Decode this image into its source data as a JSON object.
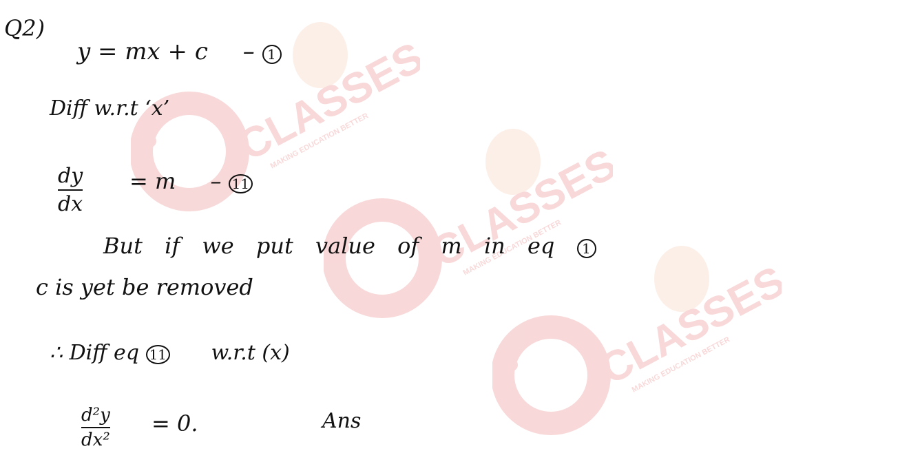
{
  "question_label": "Q2)",
  "eq1": {
    "text": "y = mx + c",
    "dash": "–",
    "tag": "1"
  },
  "step_diff1": "Diff  w.r.t  ‘x’",
  "eq2": {
    "num": "dy",
    "den": "dx",
    "rhs": "=   m",
    "dash": "–",
    "tag": "11"
  },
  "note_line1": {
    "text": "But if we put value of m in eq",
    "tag": "1"
  },
  "note_line2": "c is yet be removed",
  "step_diff2": {
    "prefix": "∴  Diff  eq",
    "tag": "11",
    "suffix": "w.r.t (x)"
  },
  "eq3": {
    "num": "d²y",
    "den": "dx²",
    "rhs": "=  0.",
    "ans": "Ans"
  },
  "watermark": {
    "brand": "CLASSES",
    "tagline": "MAKING EDUCATION BETTER",
    "color": "#f7d2d2"
  }
}
